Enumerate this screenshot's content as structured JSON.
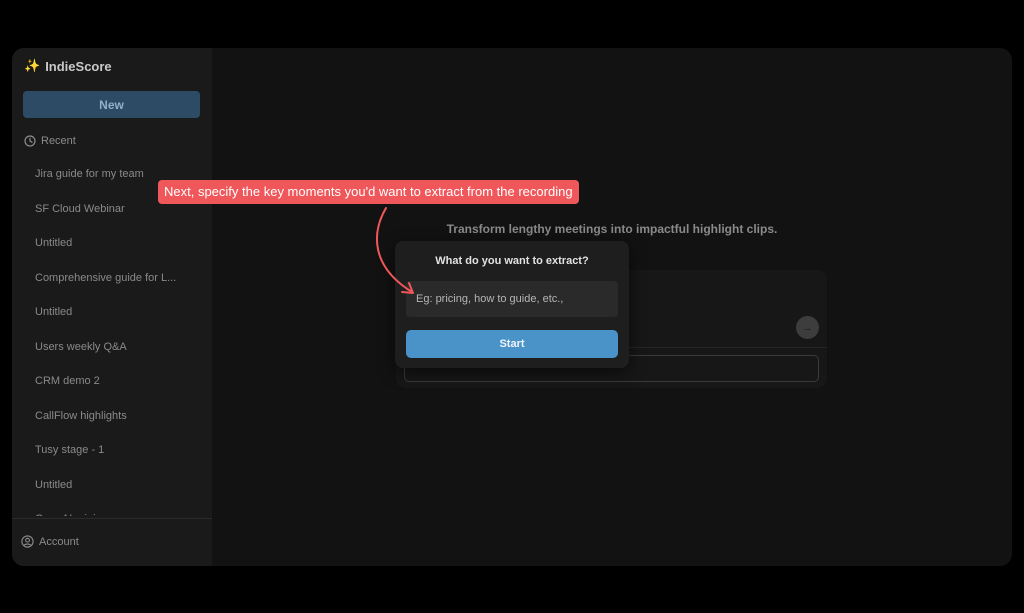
{
  "app": {
    "name": "IndieScore"
  },
  "sidebar": {
    "new_label": "New",
    "recent_label": "Recent",
    "items": [
      "Jira guide for my team",
      "SF Cloud Webinar",
      "Untitled",
      "Comprehensive guide for L...",
      "Untitled",
      "Users weekly Q&A",
      "CRM demo 2",
      "CallFlow highlights",
      "Tusy stage - 1",
      "Untitled",
      "OpenAI mini"
    ],
    "account_label": "Account"
  },
  "main": {
    "headline": "Transform lengthy meetings into impactful highlight clips."
  },
  "dialog": {
    "title": "What do you want to extract?",
    "placeholder": "Eg: pricing, how to guide, etc.,",
    "start_label": "Start"
  },
  "callout": {
    "text": "Next, specify the key moments you'd want to extract from the recording"
  },
  "colors": {
    "accent": "#4a93c9",
    "callout": "#f0575a",
    "new_button": "#2e4b66"
  }
}
